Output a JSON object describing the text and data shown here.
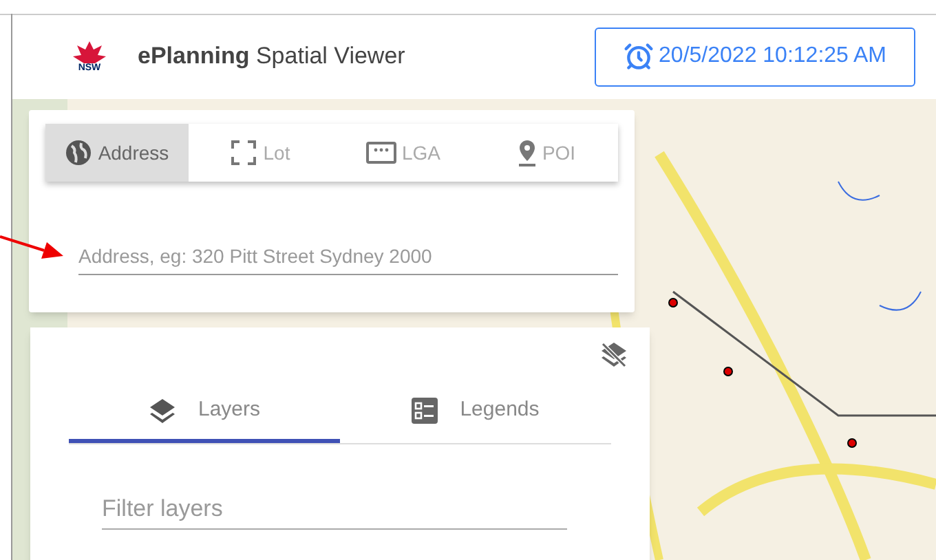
{
  "header": {
    "logo_text": "NSW",
    "title_bold": "ePlanning",
    "title_rest": "Spatial Viewer",
    "datetime": "20/5/2022 10:12:25 AM"
  },
  "search": {
    "tabs": [
      {
        "label": "Address",
        "kind": "globe",
        "selected": true
      },
      {
        "label": "Lot",
        "kind": "frame",
        "selected": false
      },
      {
        "label": "LGA",
        "kind": "dots",
        "selected": false
      },
      {
        "label": "POI",
        "kind": "pin",
        "selected": false
      }
    ],
    "placeholder": "Address, eg: 320 Pitt Street Sydney 2000"
  },
  "panel": {
    "tabs": [
      {
        "label": "Layers",
        "kind": "layers",
        "selected": true
      },
      {
        "label": "Legends",
        "kind": "legend",
        "selected": false
      }
    ],
    "filter_placeholder": "Filter layers"
  }
}
